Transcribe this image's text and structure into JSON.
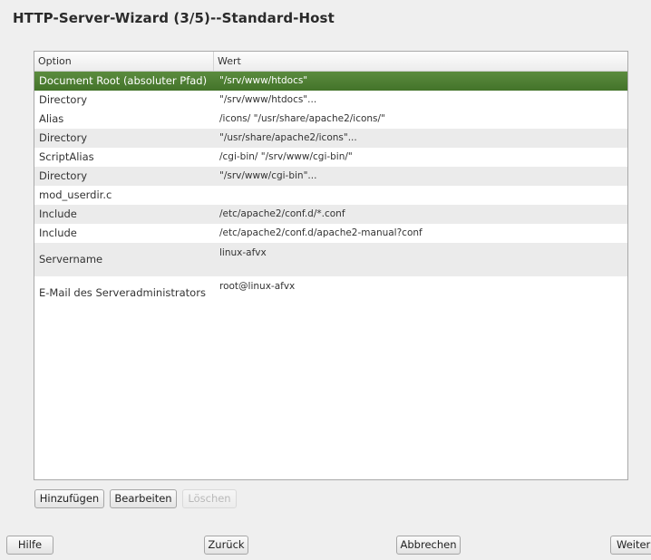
{
  "window": {
    "title": "HTTP-Server-Wizard (3/5)--Standard-Host"
  },
  "table": {
    "headers": [
      "Option",
      "Wert"
    ],
    "rows": [
      {
        "option": "Document Root (absoluter Pfad)",
        "value": "\"/srv/www/htdocs\""
      },
      {
        "option": "Directory",
        "value": "\"/srv/www/htdocs\"..."
      },
      {
        "option": "Alias",
        "value": "/icons/ \"/usr/share/apache2/icons/\""
      },
      {
        "option": "Directory",
        "value": "\"/usr/share/apache2/icons\"..."
      },
      {
        "option": "ScriptAlias",
        "value": "/cgi-bin/ \"/srv/www/cgi-bin/\""
      },
      {
        "option": "Directory",
        "value": "\"/srv/www/cgi-bin\"..."
      },
      {
        "option": "mod_userdir.c",
        "value": ""
      },
      {
        "option": "Include",
        "value": "/etc/apache2/conf.d/*.conf"
      },
      {
        "option": "Include",
        "value": "/etc/apache2/conf.d/apache2-manual?conf"
      },
      {
        "option": "Servername",
        "value": "linux-afvx"
      },
      {
        "option": "E-Mail des Serveradministrators",
        "value": "root@linux-afvx"
      }
    ]
  },
  "actions": {
    "add": "Hinzufügen",
    "edit": "Bearbeiten",
    "delete": "Löschen"
  },
  "footer": {
    "help": "Hilfe",
    "back": "Zurück",
    "cancel": "Abbrechen",
    "next": "Weiter"
  },
  "colors": {
    "selection": "#4f8034",
    "row_alt": "#ebebeb",
    "window_bg": "#efefef"
  }
}
